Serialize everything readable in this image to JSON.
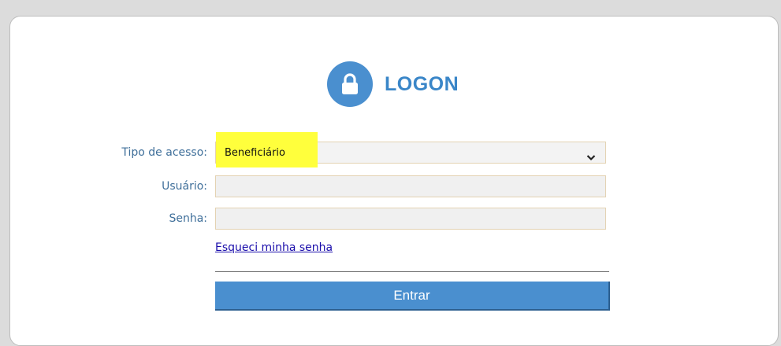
{
  "header": {
    "icon": "lock-icon",
    "title": "LOGON",
    "accent_color": "#4a8fcf"
  },
  "form": {
    "access_type": {
      "label": "Tipo de acesso:",
      "selected_value": "Beneficiário",
      "highlight_color": "#ffff3c"
    },
    "username": {
      "label": "Usuário:",
      "value": ""
    },
    "password": {
      "label": "Senha:",
      "value": ""
    },
    "forgot_password_link": "Esqueci minha senha",
    "submit_label": "Entrar"
  }
}
